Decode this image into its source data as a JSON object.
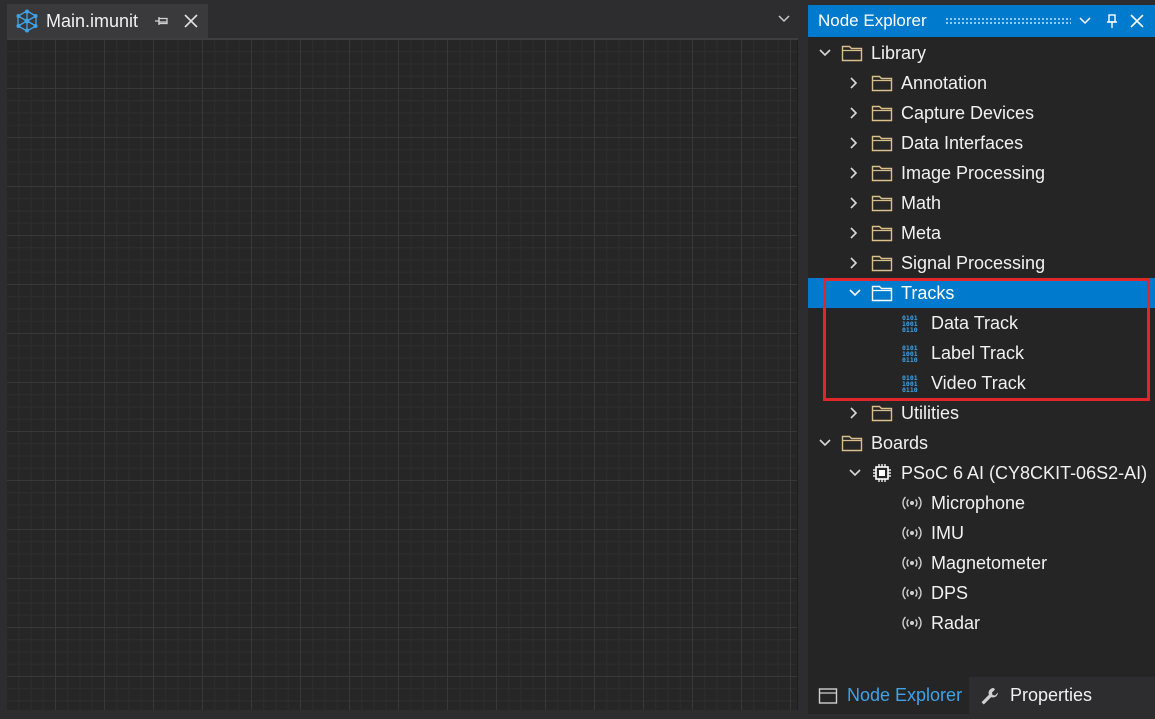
{
  "document": {
    "tab_title": "Main.imunit"
  },
  "panel": {
    "title": "Node Explorer",
    "tree": {
      "library": {
        "label": "Library"
      },
      "library_items": [
        {
          "label": "Annotation"
        },
        {
          "label": "Capture Devices"
        },
        {
          "label": "Data Interfaces"
        },
        {
          "label": "Image Processing"
        },
        {
          "label": "Math"
        },
        {
          "label": "Meta"
        },
        {
          "label": "Signal Processing"
        }
      ],
      "tracks": {
        "label": "Tracks",
        "children": [
          {
            "label": "Data Track"
          },
          {
            "label": "Label Track"
          },
          {
            "label": "Video Track"
          }
        ]
      },
      "utilities": {
        "label": "Utilities"
      },
      "boards": {
        "label": "Boards"
      },
      "board": {
        "label": "PSoC 6 AI (CY8CKIT-06S2-AI)",
        "sensors": [
          {
            "label": "Microphone"
          },
          {
            "label": "IMU"
          },
          {
            "label": "Magnetometer"
          },
          {
            "label": "DPS"
          },
          {
            "label": "Radar"
          }
        ]
      }
    }
  },
  "bottom_tabs": {
    "node_explorer": "Node Explorer",
    "properties": "Properties"
  },
  "colors": {
    "accent": "#007acc",
    "highlight": "#e0262a",
    "folder": "#d9c08a"
  }
}
